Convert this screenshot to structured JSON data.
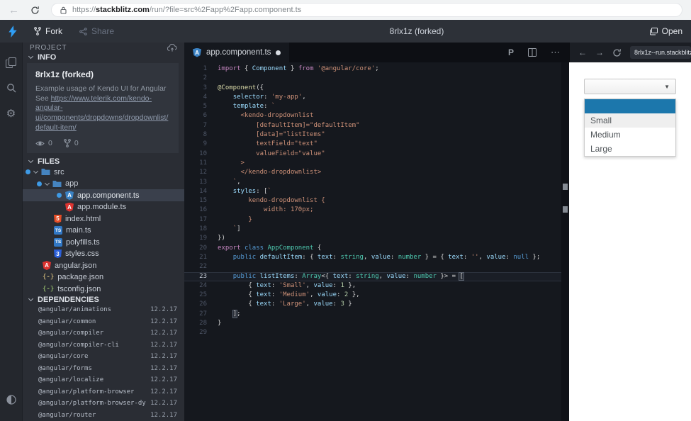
{
  "browser": {
    "back_glyph": "←",
    "url": {
      "prefix": "https://",
      "domain": "stackblitz.com",
      "path": "/run/?file=src%2Fapp%2Fapp.component.ts"
    }
  },
  "header": {
    "fork": "Fork",
    "share": "Share",
    "title": "8rlx1z (forked)",
    "open": "Open"
  },
  "sidebar": {
    "project_label": "PROJECT",
    "info": {
      "label": "INFO",
      "title": "8rlx1z (forked)",
      "desc": "Example usage of Kendo UI for Angular",
      "see": "See ",
      "link": "https://www.telerik.com/kendo-angular-ui/components/dropdowns/dropdownlist/default-item/",
      "views": "0",
      "forks": "0"
    },
    "files": {
      "label": "FILES",
      "items": [
        {
          "label": "src",
          "icon": "folder",
          "depth": 0,
          "dot": true,
          "chev": true,
          "selected": false
        },
        {
          "label": "app",
          "icon": "folder",
          "depth": 1,
          "dot": true,
          "chev": true,
          "selected": false
        },
        {
          "label": "app.component.ts",
          "icon": "ng-blue",
          "depth": 2,
          "dot": true,
          "chev": false,
          "selected": true
        },
        {
          "label": "app.module.ts",
          "icon": "ng-red",
          "depth": 2,
          "dot": false,
          "chev": false,
          "selected": false
        },
        {
          "label": "index.html",
          "icon": "html",
          "depth": 1,
          "dot": false,
          "chev": false,
          "selected": false
        },
        {
          "label": "main.ts",
          "icon": "ts",
          "depth": 1,
          "dot": false,
          "chev": false,
          "selected": false
        },
        {
          "label": "polyfills.ts",
          "icon": "ts",
          "depth": 1,
          "dot": false,
          "chev": false,
          "selected": false
        },
        {
          "label": "styles.css",
          "icon": "css",
          "depth": 1,
          "dot": false,
          "chev": false,
          "selected": false
        },
        {
          "label": "angular.json",
          "icon": "ng-red",
          "depth": 0,
          "dot": false,
          "chev": false,
          "selected": false
        },
        {
          "label": "package.json",
          "icon": "braces",
          "depth": 0,
          "dot": false,
          "chev": false,
          "selected": false
        },
        {
          "label": "tsconfig.json",
          "icon": "braces-green",
          "depth": 0,
          "dot": false,
          "chev": false,
          "selected": false
        }
      ]
    },
    "dependencies": {
      "label": "DEPENDENCIES",
      "items": [
        {
          "name": "@angular/animations",
          "version": "12.2.17"
        },
        {
          "name": "@angular/common",
          "version": "12.2.17"
        },
        {
          "name": "@angular/compiler",
          "version": "12.2.17"
        },
        {
          "name": "@angular/compiler-cli",
          "version": "12.2.17"
        },
        {
          "name": "@angular/core",
          "version": "12.2.17"
        },
        {
          "name": "@angular/forms",
          "version": "12.2.17"
        },
        {
          "name": "@angular/localize",
          "version": "12.2.17"
        },
        {
          "name": "@angular/platform-browser",
          "version": "12.2.17"
        },
        {
          "name": "@angular/platform-browser-dynamic",
          "version": "12.2.17"
        },
        {
          "name": "@angular/router",
          "version": "12.2.17"
        }
      ]
    }
  },
  "editor": {
    "tab": {
      "label": "app.component.ts"
    },
    "active_line": 23,
    "lines": [
      [
        [
          "kw",
          "import"
        ],
        [
          "pun",
          " { "
        ],
        [
          "var",
          "Component"
        ],
        [
          "pun",
          " } "
        ],
        [
          "kw",
          "from"
        ],
        [
          "pun",
          " "
        ],
        [
          "str",
          "'@angular/core'"
        ],
        [
          "pun",
          ";"
        ]
      ],
      [],
      [
        [
          "dec",
          "@Component"
        ],
        [
          "pun",
          "({"
        ]
      ],
      [
        [
          "pun",
          "    "
        ],
        [
          "var",
          "selector"
        ],
        [
          "pun",
          ": "
        ],
        [
          "str",
          "'my-app'"
        ],
        [
          "pun",
          ","
        ]
      ],
      [
        [
          "pun",
          "    "
        ],
        [
          "var",
          "template"
        ],
        [
          "pun",
          ": "
        ],
        [
          "str",
          "`"
        ]
      ],
      [
        [
          "str",
          "      <kendo-dropdownlist"
        ]
      ],
      [
        [
          "str",
          "          [defaultItem]=\"defaultItem\""
        ]
      ],
      [
        [
          "str",
          "          [data]=\"listItems\""
        ]
      ],
      [
        [
          "str",
          "          textField=\"text\""
        ]
      ],
      [
        [
          "str",
          "          valueField=\"value\""
        ]
      ],
      [
        [
          "str",
          "      >"
        ]
      ],
      [
        [
          "str",
          "      </kendo-dropdownlist>"
        ]
      ],
      [
        [
          "pun",
          "    "
        ],
        [
          "str",
          "`"
        ],
        [
          "pun",
          ","
        ]
      ],
      [
        [
          "pun",
          "    "
        ],
        [
          "var",
          "styles"
        ],
        [
          "pun",
          ": ["
        ],
        [
          "str",
          "`"
        ]
      ],
      [
        [
          "str",
          "        kendo-dropdownlist {"
        ]
      ],
      [
        [
          "str",
          "            width: 170px;"
        ]
      ],
      [
        [
          "str",
          "        }"
        ]
      ],
      [
        [
          "pun",
          "    "
        ],
        [
          "str",
          "`"
        ],
        [
          "pun",
          "]"
        ]
      ],
      [
        [
          "pun",
          "})"
        ]
      ],
      [
        [
          "kw",
          "export"
        ],
        [
          "pun",
          " "
        ],
        [
          "kw2",
          "class"
        ],
        [
          "pun",
          " "
        ],
        [
          "type",
          "AppComponent"
        ],
        [
          "pun",
          " {"
        ]
      ],
      [
        [
          "pun",
          "    "
        ],
        [
          "kw2",
          "public"
        ],
        [
          "pun",
          " "
        ],
        [
          "var",
          "defaultItem"
        ],
        [
          "pun",
          ": { "
        ],
        [
          "var",
          "text"
        ],
        [
          "pun",
          ": "
        ],
        [
          "type",
          "string"
        ],
        [
          "pun",
          ", "
        ],
        [
          "var",
          "value"
        ],
        [
          "pun",
          ": "
        ],
        [
          "type",
          "number"
        ],
        [
          "pun",
          " } = { "
        ],
        [
          "var",
          "text"
        ],
        [
          "pun",
          ": "
        ],
        [
          "str",
          "''"
        ],
        [
          "pun",
          ", "
        ],
        [
          "var",
          "value"
        ],
        [
          "pun",
          ": "
        ],
        [
          "kw2",
          "null"
        ],
        [
          "pun",
          " };"
        ]
      ],
      [],
      [
        [
          "pun",
          "    "
        ],
        [
          "kw2",
          "public"
        ],
        [
          "pun",
          " "
        ],
        [
          "var",
          "listItems"
        ],
        [
          "pun",
          ": "
        ],
        [
          "type",
          "Array"
        ],
        [
          "pun",
          "<{ "
        ],
        [
          "var",
          "text"
        ],
        [
          "pun",
          ": "
        ],
        [
          "type",
          "string"
        ],
        [
          "pun",
          ", "
        ],
        [
          "var",
          "value"
        ],
        [
          "pun",
          ": "
        ],
        [
          "type",
          "number"
        ],
        [
          "pun",
          " }> = "
        ],
        [
          "brk",
          "["
        ]
      ],
      [
        [
          "pun",
          "        { "
        ],
        [
          "var",
          "text"
        ],
        [
          "pun",
          ": "
        ],
        [
          "str",
          "'Small'"
        ],
        [
          "pun",
          ", "
        ],
        [
          "var",
          "value"
        ],
        [
          "pun",
          ": "
        ],
        [
          "num",
          "1"
        ],
        [
          "pun",
          " },"
        ]
      ],
      [
        [
          "pun",
          "        { "
        ],
        [
          "var",
          "text"
        ],
        [
          "pun",
          ": "
        ],
        [
          "str",
          "'Medium'"
        ],
        [
          "pun",
          ", "
        ],
        [
          "var",
          "value"
        ],
        [
          "pun",
          ": "
        ],
        [
          "num",
          "2"
        ],
        [
          "pun",
          " },"
        ]
      ],
      [
        [
          "pun",
          "        { "
        ],
        [
          "var",
          "text"
        ],
        [
          "pun",
          ": "
        ],
        [
          "str",
          "'Large'"
        ],
        [
          "pun",
          ", "
        ],
        [
          "var",
          "value"
        ],
        [
          "pun",
          ": "
        ],
        [
          "num",
          "3"
        ],
        [
          "pun",
          " }"
        ]
      ],
      [
        [
          "pun",
          "    "
        ],
        [
          "brk",
          "]"
        ],
        [
          "pun",
          ";"
        ]
      ],
      [
        [
          "pun",
          "}"
        ]
      ],
      []
    ]
  },
  "preview": {
    "url": "8rlx1z--run.stackblitz",
    "dropdown": {
      "arrow": "▼",
      "accent": "#1c77ac",
      "hover_color": "#efefef",
      "items": [
        "",
        "Small",
        "Medium",
        "Large"
      ],
      "selected_index": 0,
      "hover_index": 1
    }
  },
  "glyphs": {
    "more": "⋯",
    "back": "←",
    "forward": "→",
    "prettier": "P",
    "gear": "⚙",
    "braces": "{-}"
  }
}
